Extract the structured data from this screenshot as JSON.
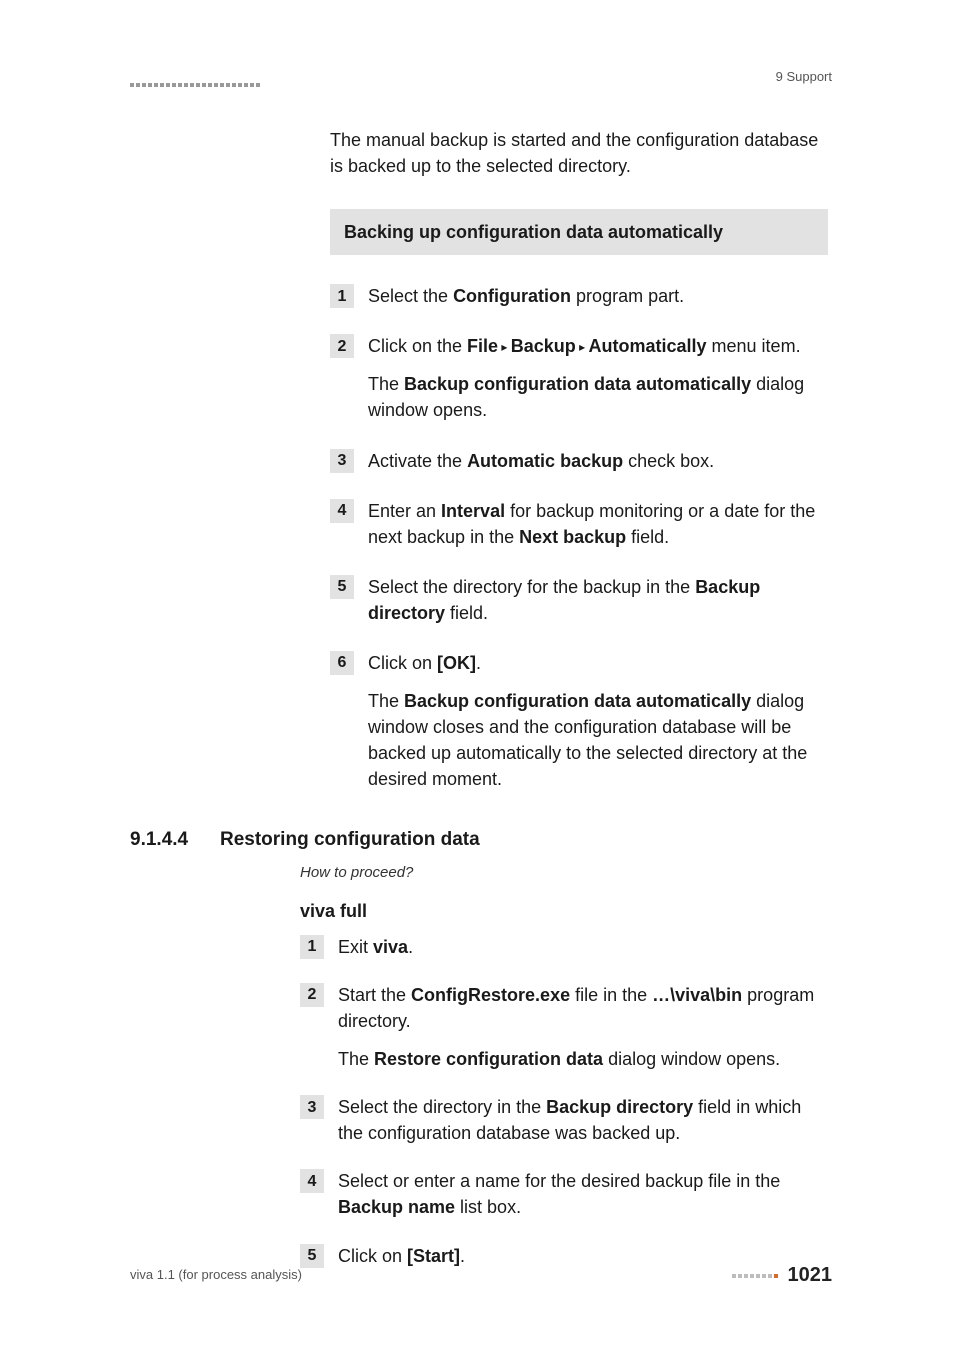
{
  "header": {
    "breadcrumb": "9 Support"
  },
  "intro_para": {
    "text_a": "The manual backup is started and the configuration database is backed up to the selected directory."
  },
  "box1": {
    "heading": "Backing up configuration data automatically",
    "steps": [
      {
        "n": "1",
        "line1_pre": "Select the ",
        "line1_b1": "Configuration",
        "line1_post": " program part."
      },
      {
        "n": "2",
        "line1_pre": "Click on the ",
        "line1_b1": "File",
        "line1_sep1": " ▸ ",
        "line1_b2": "Backup",
        "line1_sep2": " ▸ ",
        "line1_b3": "Automatically",
        "line1_post": " menu item.",
        "line2_pre": "The ",
        "line2_b1": "Backup configuration data automatically",
        "line2_post": " dialog window opens."
      },
      {
        "n": "3",
        "line1_pre": "Activate the ",
        "line1_b1": "Automatic backup",
        "line1_post": " check box."
      },
      {
        "n": "4",
        "line1_pre": "Enter an ",
        "line1_b1": "Interval",
        "line1_mid": " for backup monitoring or a date for the next backup in the ",
        "line1_b2": "Next backup",
        "line1_post": " field."
      },
      {
        "n": "5",
        "line1_pre": "Select the directory for the backup in the ",
        "line1_b1": "Backup directory",
        "line1_post": " field."
      },
      {
        "n": "6",
        "line1_pre": "Click on ",
        "line1_b1": "[OK]",
        "line1_post": ".",
        "line2_pre": "The ",
        "line2_b1": "Backup configuration data automatically",
        "line2_post": " dialog window closes and the configuration database will be backed up automatically to the selected directory at the desired moment."
      }
    ]
  },
  "section": {
    "num": "9.1.4.4",
    "title": "Restoring configuration data",
    "howto": "How to proceed?",
    "sub_label": "viva full",
    "steps": [
      {
        "n": "1",
        "line1_pre": "Exit ",
        "line1_b1": "viva",
        "line1_post": "."
      },
      {
        "n": "2",
        "line1_pre": "Start the ",
        "line1_b1": "ConfigRestore.exe",
        "line1_mid": " file in the ",
        "line1_b2": "…\\viva\\bin",
        "line1_post": " program directory.",
        "line2_pre": "The ",
        "line2_b1": "Restore configuration data",
        "line2_post": " dialog window opens."
      },
      {
        "n": "3",
        "line1_pre": "Select the directory in the ",
        "line1_b1": "Backup directory",
        "line1_post": " field in which the configuration database was backed up."
      },
      {
        "n": "4",
        "line1_pre": "Select or enter a name for the desired backup file in the ",
        "line1_b1": "Backup name",
        "line1_post": " list box."
      },
      {
        "n": "5",
        "line1_pre": "Click on ",
        "line1_b1": "[Start]",
        "line1_post": "."
      }
    ]
  },
  "footer": {
    "left": "viva 1.1 (for process analysis)",
    "page": "1021"
  }
}
